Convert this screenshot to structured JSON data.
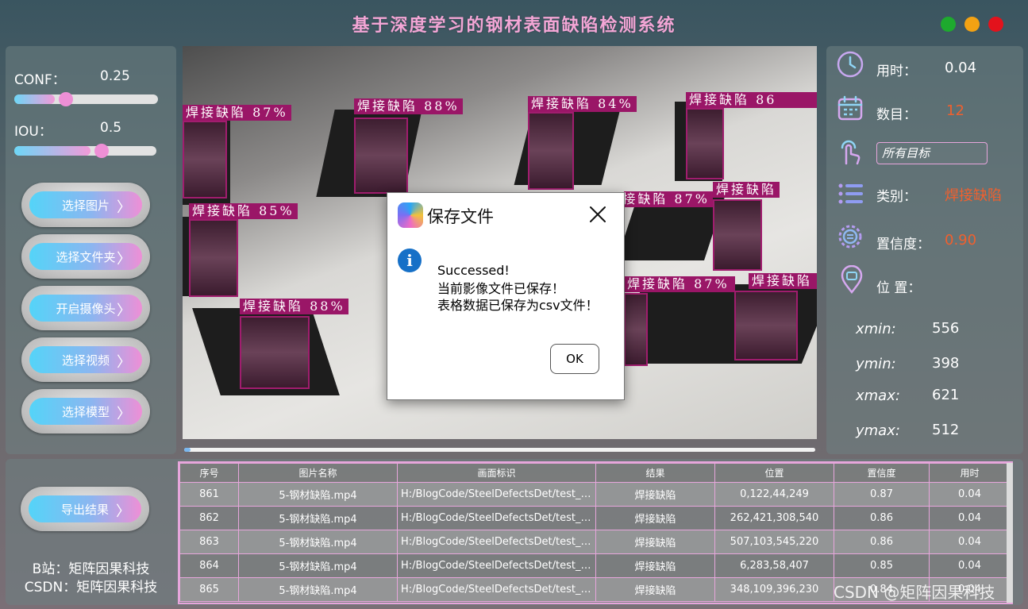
{
  "app": {
    "title": "基于深度学习的钢材表面缺陷检测系统"
  },
  "sliders": {
    "conf": {
      "label": "CONF：",
      "value": "0.25",
      "fraction": 0.25
    },
    "iou": {
      "label": "IOU：",
      "value": "0.5",
      "fraction": 0.5
    }
  },
  "buttons": {
    "select_image": "选择图片",
    "select_folder": "选择文件夹",
    "open_camera": "开启摄像头",
    "select_video": "选择视频",
    "select_model": "选择模型",
    "export": "导出结果"
  },
  "credits": {
    "bilibili": "B站：矩阵因果科技",
    "csdn": "CSDN：矩阵因果科技"
  },
  "detections": [
    {
      "label": "焊接缺陷 87%"
    },
    {
      "label": "焊接缺陷 88%"
    },
    {
      "label": "焊接缺陷 84%"
    },
    {
      "label": "焊接缺陷 86"
    },
    {
      "label": "焊接缺陷 85%"
    },
    {
      "label": "焊接缺陷 87%"
    },
    {
      "label": "焊接缺陷"
    },
    {
      "label": "焊接缺陷 88%"
    },
    {
      "label": "焊接缺陷 87%"
    },
    {
      "label": "焊接缺陷"
    }
  ],
  "video_progress": 0.01,
  "info": {
    "time_label": "用时：",
    "time_value": "0.04",
    "count_label": "数目：",
    "count_value": "12",
    "target_select": "所有目标",
    "class_label": "类别：",
    "class_value": "焊接缺陷",
    "conf_label": "置信度：",
    "conf_value": "0.90",
    "pos_label": "位 置：",
    "xmin_label": "xmin:",
    "xmin_value": "556",
    "ymin_label": "ymin:",
    "ymin_value": "398",
    "xmax_label": "xmax:",
    "xmax_value": "621",
    "ymax_label": "ymax:",
    "ymax_value": "512"
  },
  "table": {
    "headers": [
      "序号",
      "图片名称",
      "画面标识",
      "结果",
      "位置",
      "置信度",
      "用时"
    ],
    "rows": [
      [
        "861",
        "5-钢材缺陷.mp4",
        "H:/BlogCode/SteelDefectsDet/test_m...",
        "焊接缺陷",
        "0,122,44,249",
        "0.87",
        "0.04"
      ],
      [
        "862",
        "5-钢材缺陷.mp4",
        "H:/BlogCode/SteelDefectsDet/test_m...",
        "焊接缺陷",
        "262,421,308,540",
        "0.86",
        "0.04"
      ],
      [
        "863",
        "5-钢材缺陷.mp4",
        "H:/BlogCode/SteelDefectsDet/test_m...",
        "焊接缺陷",
        "507,103,545,220",
        "0.86",
        "0.04"
      ],
      [
        "864",
        "5-钢材缺陷.mp4",
        "H:/BlogCode/SteelDefectsDet/test_m...",
        "焊接缺陷",
        "6,283,58,407",
        "0.85",
        "0.04"
      ],
      [
        "865",
        "5-钢材缺陷.mp4",
        "H:/BlogCode/SteelDefectsDet/test_m...",
        "焊接缺陷",
        "348,109,396,230",
        "0.84",
        "0.04"
      ]
    ]
  },
  "watermark": "CSDN @矩阵因果科技",
  "dialog": {
    "title": "保存文件",
    "line1": "Successed!",
    "line2": "当前影像文件已保存！",
    "line3": "表格数据已保存为csv文件！",
    "ok": "OK"
  },
  "colors": {
    "accent_pink": "#f3a6d6",
    "accent_orange": "#f0602e",
    "label_magenta": "#9a1667",
    "button_cyan": "#54d4f8"
  }
}
